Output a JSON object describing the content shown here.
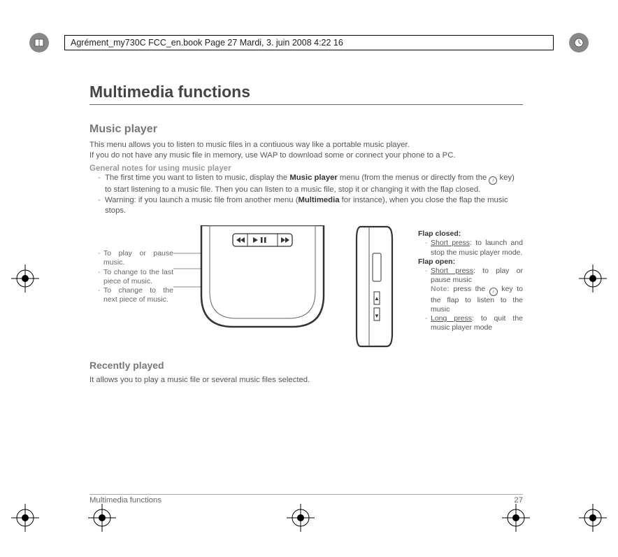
{
  "header": {
    "text": "Agrément_my730C FCC_en.book  Page 27  Mardi, 3. juin 2008  4:22 16"
  },
  "main": {
    "heading": "Multimedia functions",
    "music_player": {
      "title": "Music player",
      "intro1": "This menu allows you to listen to music files in a contiuous way like a portable music player.",
      "intro2": "If you do not have any music file in memory, use WAP to download some or connect your phone to a PC.",
      "notes_title": "General notes for using music player",
      "note1_pre": "The first time you want to listen to music, display the ",
      "note1_bold": "Music player",
      "note1_mid": " menu (from the menus or directly from the ",
      "note1_post": " key) to start listening to a music file. Then you can listen to a music file, stop it or changing it with the flap closed.",
      "note2_pre": "Warning: if you launch a music file from another menu (",
      "note2_bold": "Multimedia",
      "note2_post": " for instance), when you close the flap the music stops."
    },
    "left_callouts": {
      "c1": "To play or pause music.",
      "c2_a": "To change to the last piece of music.",
      "c2_b": "To change to the next piece of music."
    },
    "right_callouts": {
      "flap_closed": "Flap closed:",
      "fc_item_label": "Short press",
      "fc_item_text": ": to launch and stop the music player mode.",
      "flap_open": "Flap open:",
      "fo_item1_label": "Short press",
      "fo_item1_text": ": to play or pause music",
      "fo_note_label": "Note:",
      "fo_note_rest": " press the ",
      "fo_note_tail": " key to the flap to listen to the music",
      "fo_item2_label": "Long press",
      "fo_item2_text": ": to quit the music player mode"
    },
    "recently": {
      "title": "Recently played",
      "body": "It allows you to play a music file or several music files selected."
    }
  },
  "footer": {
    "left": "Multimedia functions",
    "right": "27"
  }
}
